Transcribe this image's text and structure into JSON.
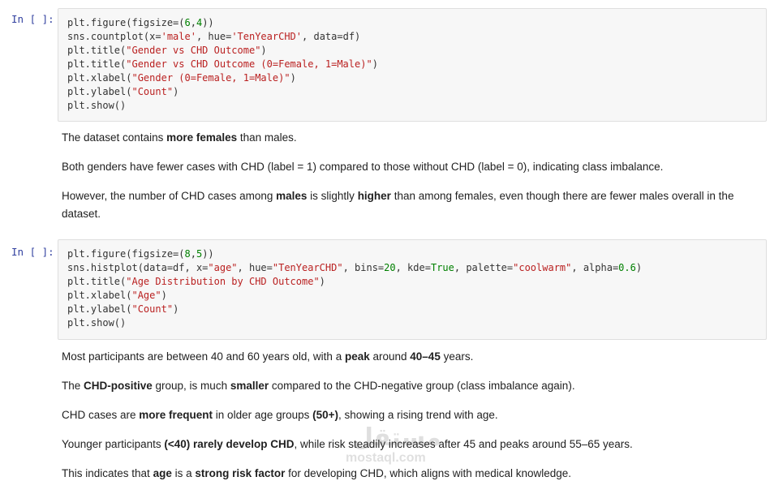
{
  "cells": [
    {
      "prompt": "In [ ]:",
      "code": [
        [
          {
            "t": "plt.figure(figsize=(",
            "c": "fn"
          },
          {
            "t": "6",
            "c": "num"
          },
          {
            "t": ",",
            "c": "p"
          },
          {
            "t": "4",
            "c": "num"
          },
          {
            "t": "))",
            "c": "p"
          }
        ],
        [
          {
            "t": "sns.countplot(x=",
            "c": "fn"
          },
          {
            "t": "'male'",
            "c": "str"
          },
          {
            "t": ", hue=",
            "c": "p"
          },
          {
            "t": "'TenYearCHD'",
            "c": "str"
          },
          {
            "t": ", data=df)",
            "c": "p"
          }
        ],
        [
          {
            "t": "plt.title(",
            "c": "fn"
          },
          {
            "t": "\"Gender vs CHD Outcome\"",
            "c": "str"
          },
          {
            "t": ")",
            "c": "p"
          }
        ],
        [
          {
            "t": "plt.title(",
            "c": "fn"
          },
          {
            "t": "\"Gender vs CHD Outcome (0=Female, 1=Male)\"",
            "c": "str"
          },
          {
            "t": ")",
            "c": "p"
          }
        ],
        [
          {
            "t": "plt.xlabel(",
            "c": "fn"
          },
          {
            "t": "\"Gender (0=Female, 1=Male)\"",
            "c": "str"
          },
          {
            "t": ")",
            "c": "p"
          }
        ],
        [
          {
            "t": "plt.ylabel(",
            "c": "fn"
          },
          {
            "t": "\"Count\"",
            "c": "str"
          },
          {
            "t": ")",
            "c": "p"
          }
        ],
        [
          {
            "t": "plt.show()",
            "c": "fn"
          }
        ]
      ]
    },
    {
      "prompt": "In [ ]:",
      "code": [
        [
          {
            "t": "plt.figure(figsize=(",
            "c": "fn"
          },
          {
            "t": "8",
            "c": "num"
          },
          {
            "t": ",",
            "c": "p"
          },
          {
            "t": "5",
            "c": "num"
          },
          {
            "t": "))",
            "c": "p"
          }
        ],
        [
          {
            "t": "sns.histplot(data=df, x=",
            "c": "fn"
          },
          {
            "t": "\"age\"",
            "c": "str"
          },
          {
            "t": ", hue=",
            "c": "p"
          },
          {
            "t": "\"TenYearCHD\"",
            "c": "str"
          },
          {
            "t": ", bins=",
            "c": "p"
          },
          {
            "t": "20",
            "c": "num"
          },
          {
            "t": ", kde=",
            "c": "p"
          },
          {
            "t": "True",
            "c": "kw"
          },
          {
            "t": ", palette=",
            "c": "p"
          },
          {
            "t": "\"coolwarm\"",
            "c": "str"
          },
          {
            "t": ", alpha=",
            "c": "p"
          },
          {
            "t": "0.6",
            "c": "num"
          },
          {
            "t": ")",
            "c": "p"
          }
        ],
        [
          {
            "t": "plt.title(",
            "c": "fn"
          },
          {
            "t": "\"Age Distribution by CHD Outcome\"",
            "c": "str"
          },
          {
            "t": ")",
            "c": "p"
          }
        ],
        [
          {
            "t": "plt.xlabel(",
            "c": "fn"
          },
          {
            "t": "\"Age\"",
            "c": "str"
          },
          {
            "t": ")",
            "c": "p"
          }
        ],
        [
          {
            "t": "plt.ylabel(",
            "c": "fn"
          },
          {
            "t": "\"Count\"",
            "c": "str"
          },
          {
            "t": ")",
            "c": "p"
          }
        ],
        [
          {
            "t": "plt.show()",
            "c": "fn"
          }
        ]
      ]
    }
  ],
  "markdown": [
    [
      [
        {
          "t": "The dataset contains "
        },
        {
          "t": "more females",
          "b": true
        },
        {
          "t": " than males."
        }
      ],
      [
        {
          "t": "Both genders have fewer cases with CHD (label = 1) compared to those without CHD (label = 0), indicating class imbalance."
        }
      ],
      [
        {
          "t": "However, the number of CHD cases among "
        },
        {
          "t": "males",
          "b": true
        },
        {
          "t": " is slightly "
        },
        {
          "t": "higher",
          "b": true
        },
        {
          "t": " than among females, even though there are fewer males overall in the dataset."
        }
      ]
    ],
    [
      [
        {
          "t": "Most participants are between 40 and 60 years old, with a "
        },
        {
          "t": "peak",
          "b": true
        },
        {
          "t": " around "
        },
        {
          "t": "40–45",
          "b": true
        },
        {
          "t": " years."
        }
      ],
      [
        {
          "t": "The "
        },
        {
          "t": "CHD-positive",
          "b": true
        },
        {
          "t": " group, is much "
        },
        {
          "t": "smaller",
          "b": true
        },
        {
          "t": " compared to the CHD-negative group (class imbalance again)."
        }
      ],
      [
        {
          "t": "CHD cases are "
        },
        {
          "t": "more frequent",
          "b": true
        },
        {
          "t": " in older age groups "
        },
        {
          "t": "(50+)",
          "b": true
        },
        {
          "t": ", showing a rising trend with age."
        }
      ],
      [
        {
          "t": "Younger participants "
        },
        {
          "t": "(<40) rarely develop CHD",
          "b": true
        },
        {
          "t": ", while risk steadily increases after 45 and peaks around 55–65 years."
        }
      ],
      [
        {
          "t": "This indicates that "
        },
        {
          "t": "age",
          "b": true
        },
        {
          "t": " is a "
        },
        {
          "t": "strong risk factor",
          "b": true
        },
        {
          "t": " for developing CHD, which aligns with medical knowledge."
        }
      ]
    ]
  ],
  "watermark": {
    "logo": "مستقل",
    "url": "mostaql.com"
  }
}
